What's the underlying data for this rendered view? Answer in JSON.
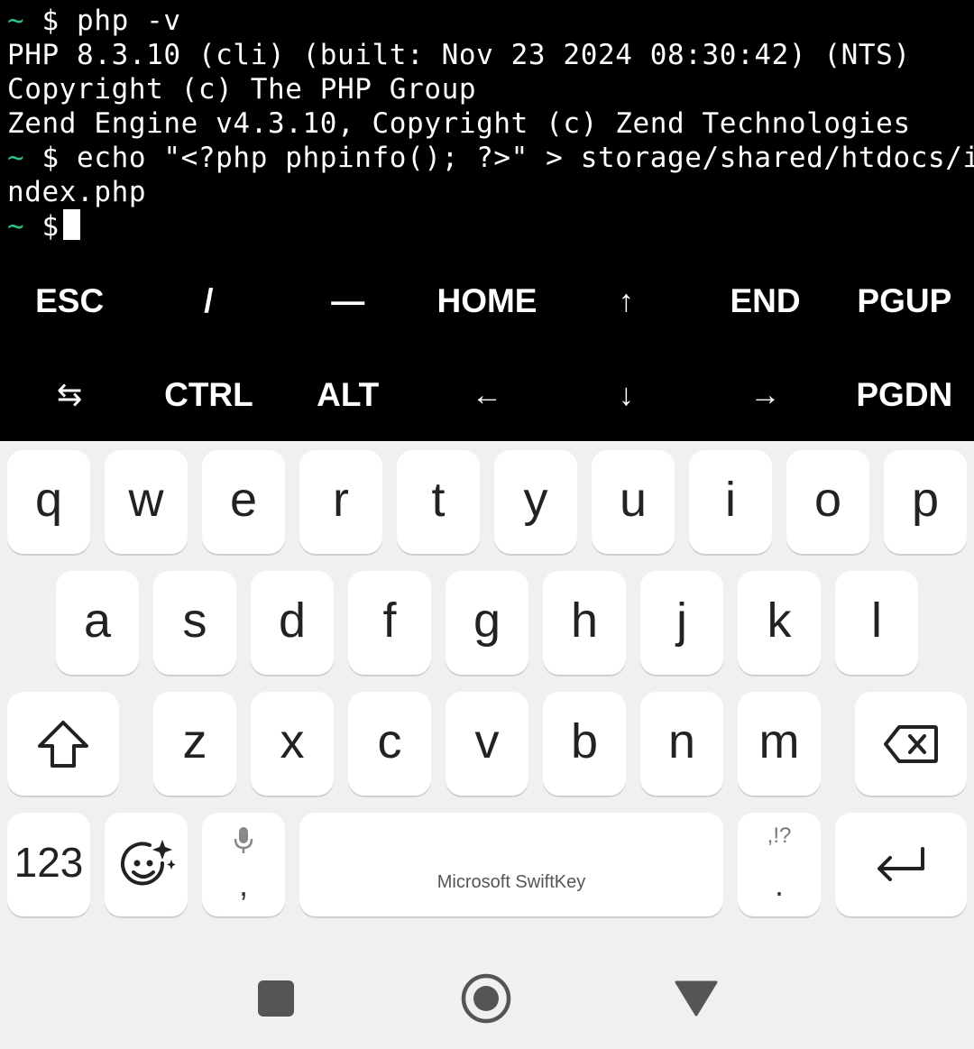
{
  "terminal": {
    "lines": [
      {
        "prompt": "~",
        "text": " $ php -v"
      },
      {
        "prompt": "",
        "text": "PHP 8.3.10 (cli) (built: Nov 23 2024 08:30:42) (NTS)"
      },
      {
        "prompt": "",
        "text": "Copyright (c) The PHP Group"
      },
      {
        "prompt": "",
        "text": "Zend Engine v4.3.10, Copyright (c) Zend Technologies"
      },
      {
        "prompt": "~",
        "text": " $ echo \"<?php phpinfo(); ?>\" > storage/shared/htdocs/i"
      },
      {
        "prompt": "",
        "text": "ndex.php"
      },
      {
        "prompt": "~",
        "text": " $"
      }
    ],
    "prompt_color": "#2ec27e"
  },
  "extra_keys": {
    "row1": [
      "ESC",
      "/",
      "—",
      "HOME",
      "↑",
      "END",
      "PGUP"
    ],
    "row2": [
      "⇆",
      "CTRL",
      "ALT",
      "←",
      "↓",
      "→",
      "PGDN"
    ]
  },
  "keyboard": {
    "row1": [
      "q",
      "w",
      "e",
      "r",
      "t",
      "y",
      "u",
      "i",
      "o",
      "p"
    ],
    "row2": [
      "a",
      "s",
      "d",
      "f",
      "g",
      "h",
      "j",
      "k",
      "l"
    ],
    "row3": [
      "z",
      "x",
      "c",
      "v",
      "b",
      "n",
      "m"
    ],
    "numbers_label": "123",
    "comma": ",",
    "space_label": "Microsoft SwiftKey",
    "period_top": ",!?",
    "period": ".",
    "icons": {
      "shift": "shift-icon",
      "backspace": "backspace-icon",
      "emoji": "emoji-icon",
      "mic": "mic-icon",
      "enter": "enter-icon"
    }
  },
  "navbar": {
    "icons": [
      "recents-icon",
      "home-icon",
      "back-icon"
    ]
  }
}
